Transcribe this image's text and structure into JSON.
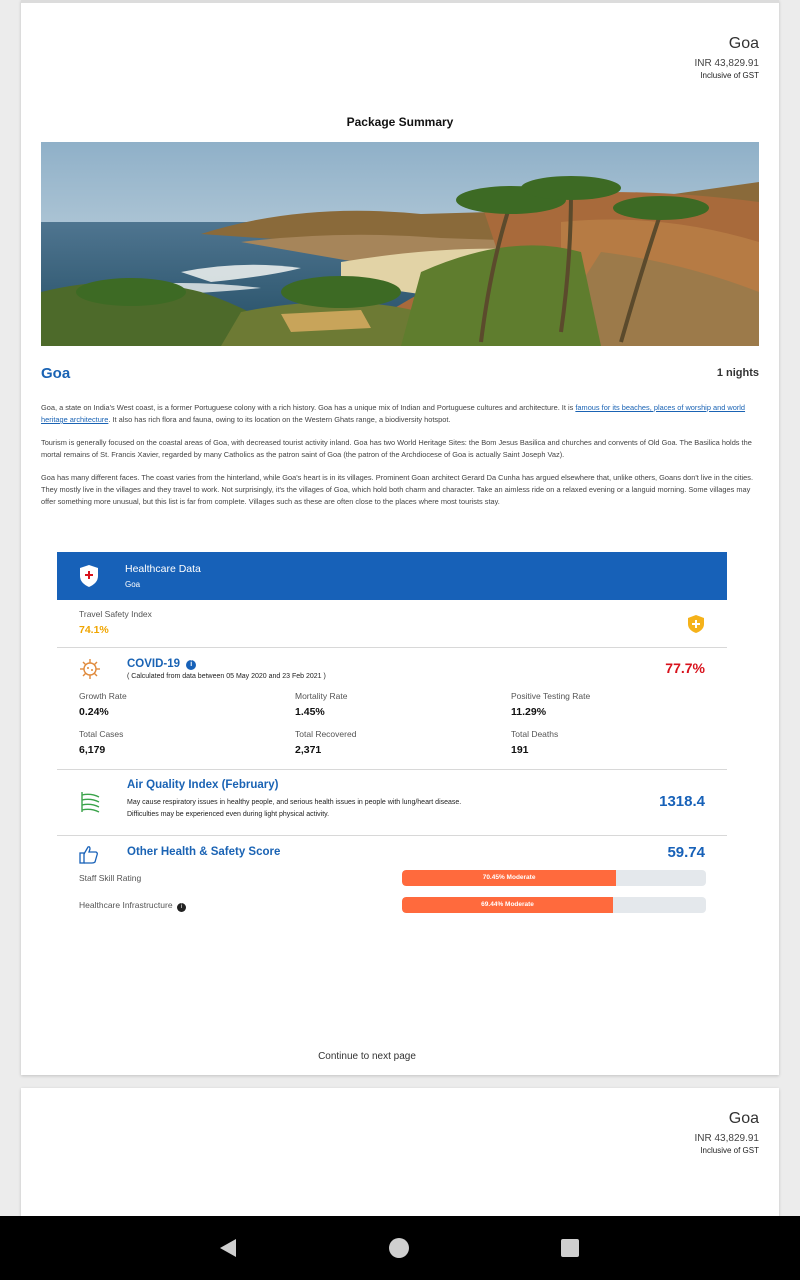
{
  "header": {
    "destination": "Goa",
    "price": "INR 43,829.91",
    "gst_note": "Inclusive of GST"
  },
  "summary_title": "Package Summary",
  "destination": {
    "name": "Goa",
    "nights": "1 nights"
  },
  "description": {
    "p1_before_link": "Goa, a state on India's West coast, is a former Portuguese colony with a rich history. Goa has a unique mix of Indian and Portuguese cultures and architecture. It is ",
    "p1_link": "famous for its beaches, places of worship and world heritage architecture",
    "p1_after_link": ". It also has rich flora and fauna, owing to its location on the Western Ghats range, a biodiversity hotspot.",
    "p2": "Tourism is generally focused on the coastal areas of Goa, with decreased tourist activity inland. Goa has two World Heritage Sites: the Bom Jesus Basilica and churches and convents of Old Goa. The Basilica holds the mortal remains of St. Francis Xavier, regarded by many Catholics as the patron saint of Goa (the patron of the Archdiocese of Goa is actually Saint Joseph Vaz).",
    "p3": "Goa has many different faces. The coast varies from the hinterland, while Goa's heart is in its villages. Prominent Goan architect Gerard Da Cunha has argued elsewhere that, unlike others, Goans don't live in the cities. They mostly live in the villages and they travel to work. Not surprisingly, it's the villages of Goa, which hold both charm and character. Take an aimless ride on a relaxed evening or a languid morning. Some villages may offer something more unusual, but this list is far from complete. Villages such as these are often close to the places where most tourists stay."
  },
  "healthcare": {
    "title": "Healthcare Data",
    "subtitle": "Goa",
    "travel_safety_label": "Travel Safety Index",
    "travel_safety_value": "74.1%",
    "covid": {
      "title": "COVID-19",
      "note": "( Calculated from data between 05 May 2020 and 23 Feb 2021 )",
      "score": "77.7%",
      "stats": [
        {
          "label": "Growth Rate",
          "value": "0.24%"
        },
        {
          "label": "Mortality Rate",
          "value": "1.45%"
        },
        {
          "label": "Positive Testing Rate",
          "value": "11.29%"
        },
        {
          "label": "Total Cases",
          "value": "6,179"
        },
        {
          "label": "Total Recovered",
          "value": "2,371"
        },
        {
          "label": "Total Deaths",
          "value": "191"
        }
      ]
    },
    "aqi": {
      "title": "Air Quality Index (February)",
      "line1": "May cause respiratory issues in healthy people, and serious health issues in people with lung/heart disease.",
      "line2": "Difficulties may be experienced even during light physical activity.",
      "value": "1318.4"
    },
    "other": {
      "title": "Other Health & Safety Score",
      "value": "59.74",
      "ratings": [
        {
          "label": "Staff Skill Rating",
          "bar_text": "70.45% Moderate",
          "percent": 70.45
        },
        {
          "label": "Healthcare Infrastructure",
          "bar_text": "69.44% Moderate",
          "percent": 69.44
        }
      ]
    }
  },
  "continue_text": "Continue to next page",
  "colors": {
    "brand_blue": "#1761b8",
    "safety_orange": "#f0a500",
    "covid_red": "#d8121c",
    "bar_orange": "#ff6a3d"
  }
}
